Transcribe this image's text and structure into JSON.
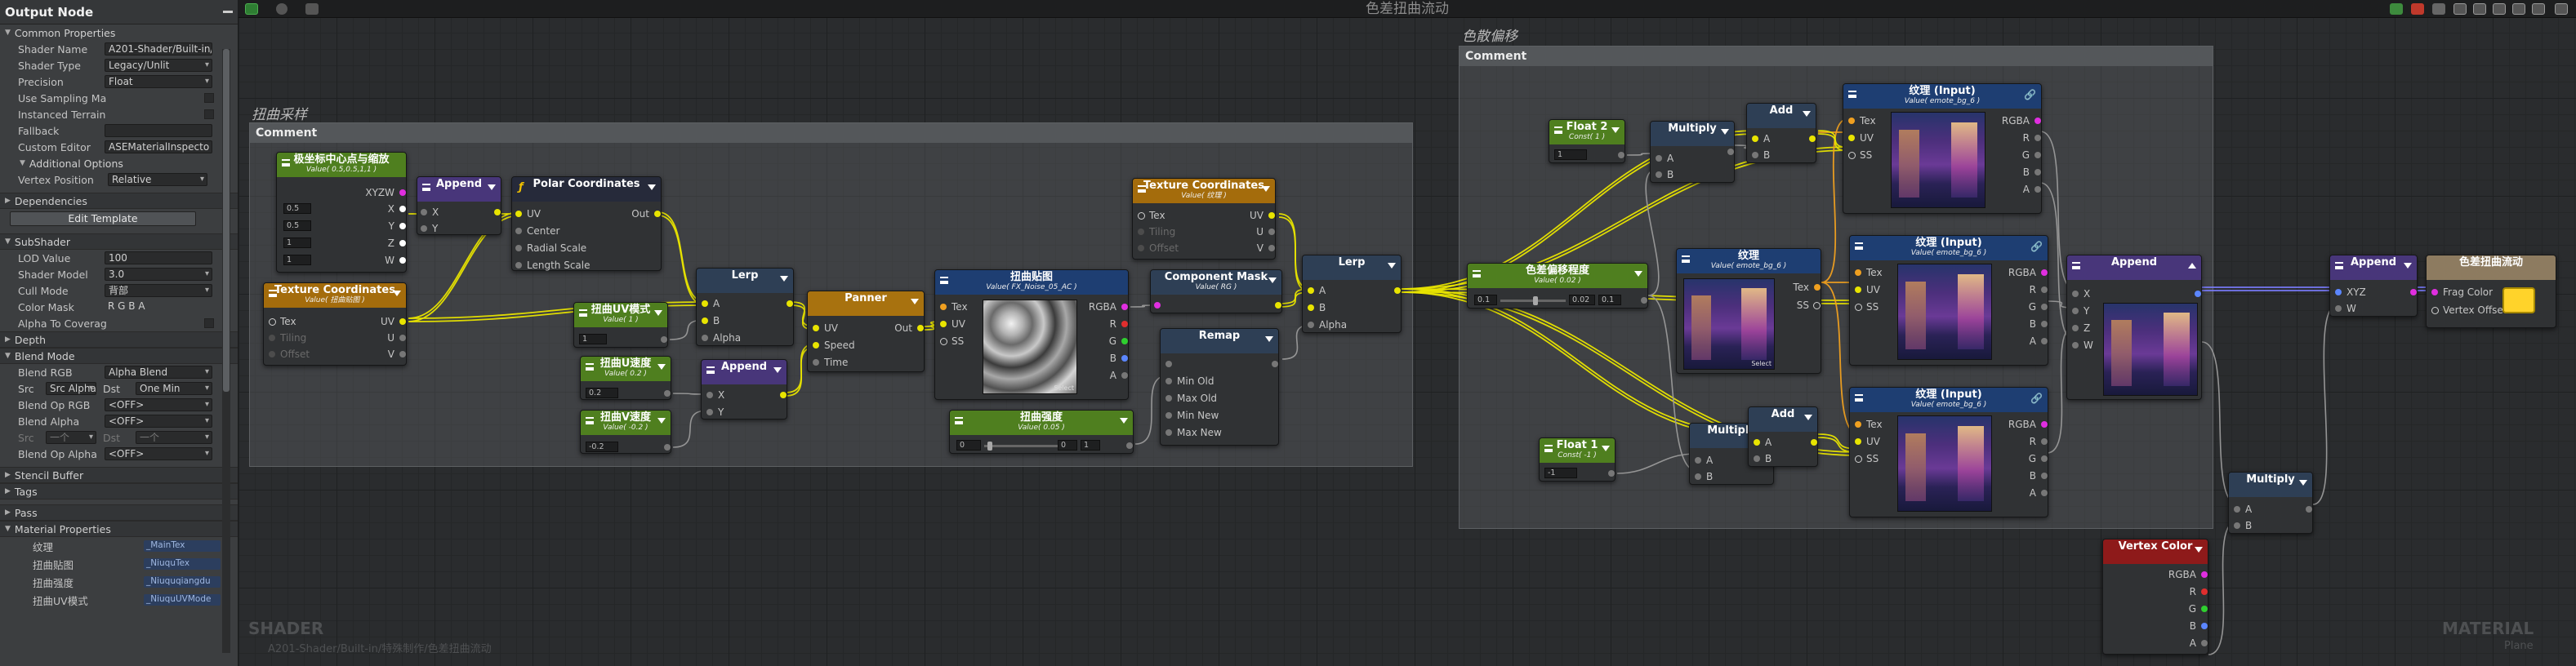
{
  "graph_title": "色差扭曲流动",
  "watermark": {
    "left": "SHADER",
    "left_sub": "A201-Shader/Built-in/特殊制作/色差扭曲流动",
    "right": "MATERIAL",
    "right_sub": "Plane"
  },
  "panel": {
    "title": "Output Node",
    "common_properties": "Common Properties",
    "rows": [
      {
        "label": "Shader Name",
        "value": "A201-Shader/Built-in/特"
      },
      {
        "label": "Shader Type",
        "value": "Legacy/Unlit"
      },
      {
        "label": "Precision",
        "value": "Float"
      },
      {
        "label": "Use Sampling Ma",
        "value": ""
      },
      {
        "label": "Instanced Terrain",
        "value": ""
      },
      {
        "label": "Fallback",
        "value": ""
      },
      {
        "label": "Custom Editor",
        "value": "ASEMaterialInspecto"
      }
    ],
    "additional_options": "Additional Options",
    "vertex_position_label": "Vertex Position",
    "vertex_position_value": "Relative",
    "dependencies": "Dependencies",
    "edit_template": "Edit Template",
    "subshader": "SubShader",
    "sub_rows": [
      {
        "label": "LOD Value",
        "value": "100"
      },
      {
        "label": "Shader Model",
        "value": "3.0"
      },
      {
        "label": "Cull Mode",
        "value": "背部"
      },
      {
        "label": "Color Mask",
        "value": "R  G  B  A"
      },
      {
        "label": "Alpha To Coverag",
        "value": ""
      }
    ],
    "depth": "Depth",
    "blend_mode": "Blend Mode",
    "blend_rows": [
      {
        "label": "Blend RGB",
        "value": "Alpha Blend"
      },
      {
        "label": "Src",
        "value": "Src Alpha",
        "dst_label": "Dst",
        "dst": "One Min"
      },
      {
        "label": "Blend Op RGB",
        "value": "<OFF>"
      },
      {
        "label": "Blend Alpha",
        "value": "<OFF>"
      },
      {
        "label": "Src",
        "value": "一个",
        "dst_label": "Dst",
        "dst": "一个"
      },
      {
        "label": "Blend Op Alpha",
        "value": "<OFF>"
      }
    ],
    "stencil_buffer": "Stencil Buffer",
    "tags": "Tags",
    "pass": "Pass",
    "material_properties": "Material Properties",
    "props": [
      {
        "label": "纹理",
        "name": "_MainTex"
      },
      {
        "label": "扭曲贴图",
        "name": "_NiuquTex"
      },
      {
        "label": "扭曲强度",
        "name": "_Niuquqiangdu"
      },
      {
        "label": "扭曲UV模式",
        "name": "_NiuquUVMode"
      }
    ]
  },
  "comments": {
    "distort": {
      "label": "扭曲采样",
      "header": "Comment"
    },
    "chroma": {
      "label": "色散偏移",
      "header": "Comment"
    }
  },
  "nodes": {
    "center_scale": {
      "title": "极坐标中心点与缩放",
      "sub": "Value( 0.5,0.5,1,1 )",
      "pin_out": "XYZW",
      "outs": [
        "X",
        "Y",
        "Z",
        "W"
      ],
      "fields": [
        "0.5",
        "0.5",
        "1",
        "1"
      ]
    },
    "append1": {
      "title": "Append",
      "ins": [
        "X",
        "Y"
      ]
    },
    "polar": {
      "title": "Polar Coordinates",
      "ins": [
        "UV",
        "Center",
        "Radial Scale",
        "Length Scale"
      ],
      "out": "Out"
    },
    "texcoord1": {
      "title": "Texture Coordinates",
      "sub": "Value( 扭曲贴图 )",
      "ins": [
        "Tex",
        "Tiling",
        "Offset"
      ],
      "outs": [
        "UV",
        "U",
        "V"
      ]
    },
    "uvmode": {
      "title": "扭曲UV模式",
      "sub": "Value( 1 )",
      "field": "1"
    },
    "lerp1": {
      "title": "Lerp",
      "ins": [
        "A",
        "B",
        "Alpha"
      ]
    },
    "speed_u": {
      "title": "扭曲U速度",
      "sub": "Value( 0.2 )",
      "field": "0.2"
    },
    "speed_v": {
      "title": "扭曲V速度",
      "sub": "Value( -0.2 )",
      "field": "-0.2"
    },
    "append2": {
      "title": "Append",
      "ins": [
        "X",
        "Y"
      ]
    },
    "panner": {
      "title": "Panner",
      "ins": [
        "UV",
        "Speed",
        "Time"
      ],
      "out": "Out"
    },
    "distort_tex": {
      "title": "扭曲贴图",
      "sub": "Value( FX_Noise_05_AC )",
      "ins": [
        "Tex",
        "UV",
        "SS"
      ],
      "outs": [
        "RGBA",
        "R",
        "G",
        "B",
        "A"
      ],
      "select": "Select"
    },
    "strength": {
      "title": "扭曲强度",
      "sub": "Value( 0.05 )",
      "fields": [
        "0",
        "0",
        "1"
      ]
    },
    "texcoord2": {
      "title": "Texture Coordinates",
      "sub": "Value( 纹理 )",
      "ins": [
        "Tex",
        "Tiling",
        "Offset"
      ],
      "outs": [
        "UV",
        "U",
        "V"
      ]
    },
    "compmask": {
      "title": "Component Mask",
      "sub": "Value( RG )"
    },
    "remap": {
      "title": "Remap",
      "ins": [
        "",
        "Min Old",
        "Max Old",
        "Min New",
        "Max New"
      ]
    },
    "lerp2": {
      "title": "Lerp",
      "ins": [
        "A",
        "B",
        "Alpha"
      ]
    },
    "float2": {
      "title": "Float 2",
      "sub": "Const( 1 )",
      "field": "1"
    },
    "float1": {
      "title": "Float 1",
      "sub": "Const( -1 )",
      "field": "-1"
    },
    "mult1": {
      "title": "Multiply",
      "ins": [
        "A",
        "B"
      ]
    },
    "mult2": {
      "title": "Multiply",
      "ins": [
        "A",
        "B"
      ]
    },
    "add1": {
      "title": "Add",
      "ins": [
        "A",
        "B"
      ]
    },
    "add2": {
      "title": "Add",
      "ins": [
        "A",
        "B"
      ]
    },
    "offset_amt": {
      "title": "色差偏移程度",
      "sub": "Value( 0.02 )",
      "fields": [
        "0.1",
        "0.02",
        "0.1"
      ]
    },
    "tex_main": {
      "title": "纹理",
      "sub": "Value( emote_bg_6 )",
      "outs": [
        "Tex",
        "SS"
      ],
      "select": "Select"
    },
    "tex_in1": {
      "title": "纹理 (Input)",
      "sub": "Value( emote_bg_6 )",
      "ins": [
        "Tex",
        "UV",
        "SS"
      ],
      "outs": [
        "RGBA",
        "R",
        "G",
        "B",
        "A"
      ]
    },
    "tex_in2": {
      "title": "纹理 (Input)",
      "sub": "Value( emote_bg_6 )",
      "ins": [
        "Tex",
        "UV",
        "SS"
      ],
      "outs": [
        "RGBA",
        "R",
        "G",
        "B",
        "A"
      ]
    },
    "tex_in3": {
      "title": "纹理 (Input)",
      "sub": "Value( emote_bg_6 )",
      "ins": [
        "Tex",
        "UV",
        "SS"
      ],
      "outs": [
        "RGBA",
        "R",
        "G",
        "B",
        "A"
      ]
    },
    "append3": {
      "title": "Append",
      "ins": [
        "X",
        "Y",
        "Z",
        "W"
      ]
    },
    "append4": {
      "title": "Append",
      "ins": [
        "XYZ",
        "W"
      ]
    },
    "mult3": {
      "title": "Multiply",
      "ins": [
        "A",
        "B"
      ]
    },
    "vcolor": {
      "title": "Vertex Color",
      "outs": [
        "RGBA",
        "R",
        "G",
        "B",
        "A"
      ]
    },
    "output": {
      "title": "色差扭曲流动",
      "ins": [
        "Frag Color",
        "Vertex Offset"
      ]
    }
  },
  "colors": {
    "yellow_wire": "#e8e400",
    "orange_wire": "#f0a020",
    "purple_wire": "#7a7cff",
    "gray_wire": "#9a9a9a"
  }
}
